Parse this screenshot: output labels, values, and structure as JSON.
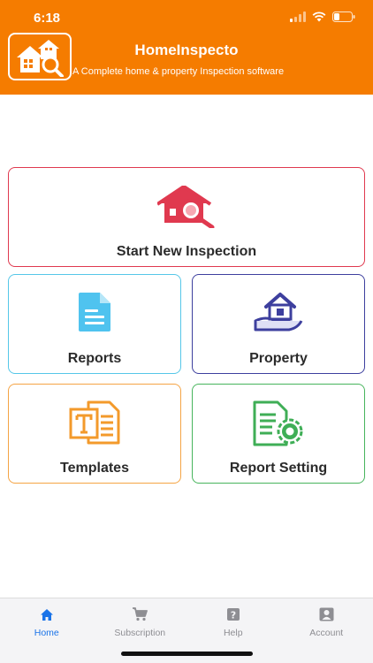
{
  "status": {
    "time": "6:18"
  },
  "app": {
    "title": "HomeInspecto",
    "subtitle": "A Complete home & property Inspection software"
  },
  "cards": {
    "start": {
      "label": "Start New Inspection",
      "icon": "house-search-icon",
      "color": "#e0394f"
    },
    "reports": {
      "label": "Reports",
      "icon": "document-icon",
      "color": "#55c7e8"
    },
    "property": {
      "label": "Property",
      "icon": "house-hand-icon",
      "color": "#3d3f9e"
    },
    "templates": {
      "label": "Templates",
      "icon": "template-icon",
      "color": "#f5a444"
    },
    "setting": {
      "label": "Report Setting",
      "icon": "document-gear-icon",
      "color": "#47b45c"
    }
  },
  "tabs": [
    {
      "label": "Home",
      "icon": "home-icon",
      "active": true
    },
    {
      "label": "Subscription",
      "icon": "cart-icon",
      "active": false
    },
    {
      "label": "Help",
      "icon": "help-icon",
      "active": false
    },
    {
      "label": "Account",
      "icon": "account-icon",
      "active": false
    }
  ],
  "colors": {
    "header": "#f57c00",
    "tab_active": "#1a73e8",
    "tab_inactive": "#8e8e93"
  }
}
